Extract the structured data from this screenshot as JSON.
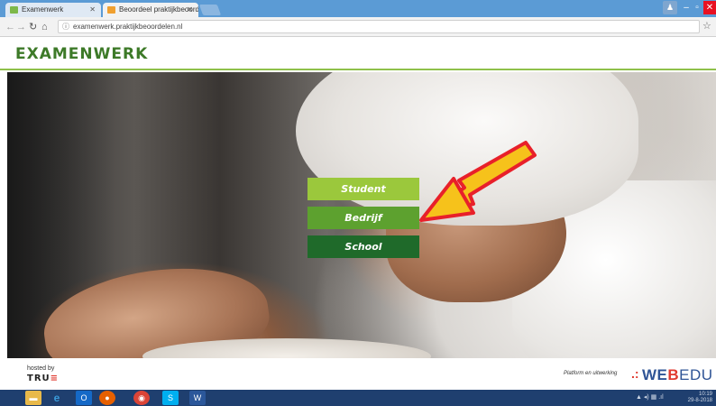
{
  "browser": {
    "tabs": [
      {
        "label": "Examenwerk",
        "active": true
      },
      {
        "label": "Beoordeel praktijkbeoordeling",
        "active": false
      }
    ],
    "address": "examenwerk.praktijkbeoordelen.nl"
  },
  "site": {
    "logo": "EXAMENWERK"
  },
  "buttons": {
    "student": "Student",
    "bedrijf": "Bedrijf",
    "school": "School"
  },
  "footer": {
    "hosted_by": "hosted by",
    "true_logo_prefix": "TRU",
    "true_logo_suffix": "≡",
    "platform_text": "Platform en uitwerking",
    "webedu_web": "WE",
    "webedu_b": "B",
    "webedu_edu": "EDU"
  },
  "taskbar": {
    "time": "10:19",
    "date": "29-8-2018"
  },
  "colors": {
    "brand_green": "#3d7a28",
    "student_button": "#9bc83c",
    "bedrijf_button": "#5da12f",
    "school_button": "#1f6a2a",
    "arrow_fill": "#f6c21b",
    "arrow_outline": "#e8202a"
  },
  "icons": [
    "file-explorer-icon",
    "internet-explorer-icon",
    "outlook-icon",
    "firefox-icon",
    "chrome-icon",
    "skype-icon",
    "word-icon"
  ]
}
